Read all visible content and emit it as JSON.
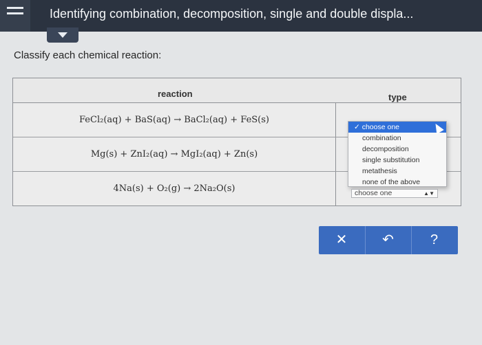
{
  "header": {
    "title": "Identifying combination, decomposition, single and double displa..."
  },
  "main": {
    "prompt": "Classify each chemical reaction:",
    "table": {
      "col_reaction": "reaction",
      "col_type": "type",
      "rows": [
        {
          "reaction": "FeCl₂(aq) + BaS(aq) → BaCl₂(aq) + FeS(s)"
        },
        {
          "reaction": "Mg(s) + ZnI₂(aq) → MgI₂(aq) + Zn(s)"
        },
        {
          "reaction": "4Na(s) + O₂(g) → 2Na₂O(s)"
        }
      ]
    },
    "dropdown": {
      "options": [
        "✓ choose one",
        "combination",
        "decomposition",
        "single substitution",
        "metathesis",
        "none of the above"
      ],
      "selected_value": "choose one"
    }
  },
  "actions": {
    "clear": "✕",
    "undo": "↶",
    "help": "?"
  }
}
